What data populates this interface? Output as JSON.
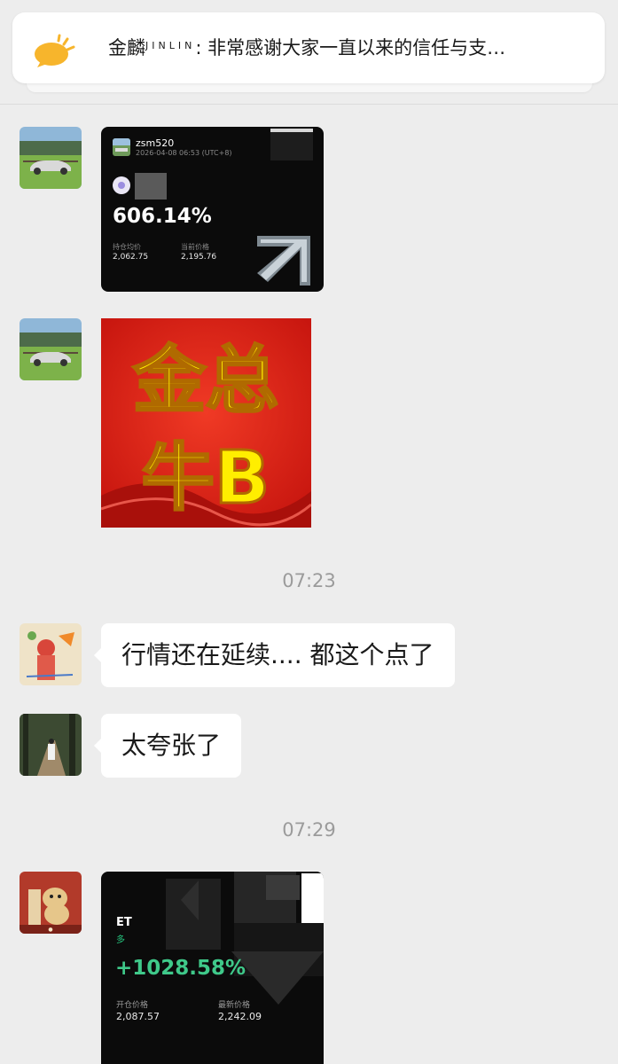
{
  "notice": {
    "sender": "金麟",
    "sender_sub": "JINLIN",
    "text": ": 非常感谢大家一直以来的信任与支…",
    "icon": "megaphone-icon"
  },
  "messages": [
    {
      "type": "image",
      "avatar": "avatar-car",
      "card": {
        "username": "zsm520",
        "date": "2026-04-08 06:53  (UTC+8)",
        "percent": "606.14%",
        "label1": "持仓均价",
        "value1": "2,062.75",
        "label2": "当前价格",
        "value2": "2,195.76"
      }
    },
    {
      "type": "image",
      "avatar": "avatar-car",
      "card": {
        "line1": "金总",
        "line2": "牛B"
      }
    },
    {
      "type": "timestamp",
      "text": "07:23"
    },
    {
      "type": "text",
      "avatar": "avatar-drawing",
      "text": "行情还在延续.... 都这个点了"
    },
    {
      "type": "text",
      "avatar": "avatar-forest",
      "text": "太夸张了"
    },
    {
      "type": "timestamp",
      "text": "07:29"
    },
    {
      "type": "image",
      "avatar": "avatar-dog",
      "card": {
        "symbol": "ET",
        "side": "多",
        "percent": "+1028.58%",
        "label1": "开仓价格",
        "value1": "2,087.57",
        "label2": "最新价格",
        "value2": "2,242.09"
      }
    }
  ],
  "colors": {
    "background": "#ededed",
    "bubble": "#ffffff",
    "profit_green": "#3fc98a",
    "banner_red": "#e0261b",
    "banner_yellow": "#ffee00"
  }
}
